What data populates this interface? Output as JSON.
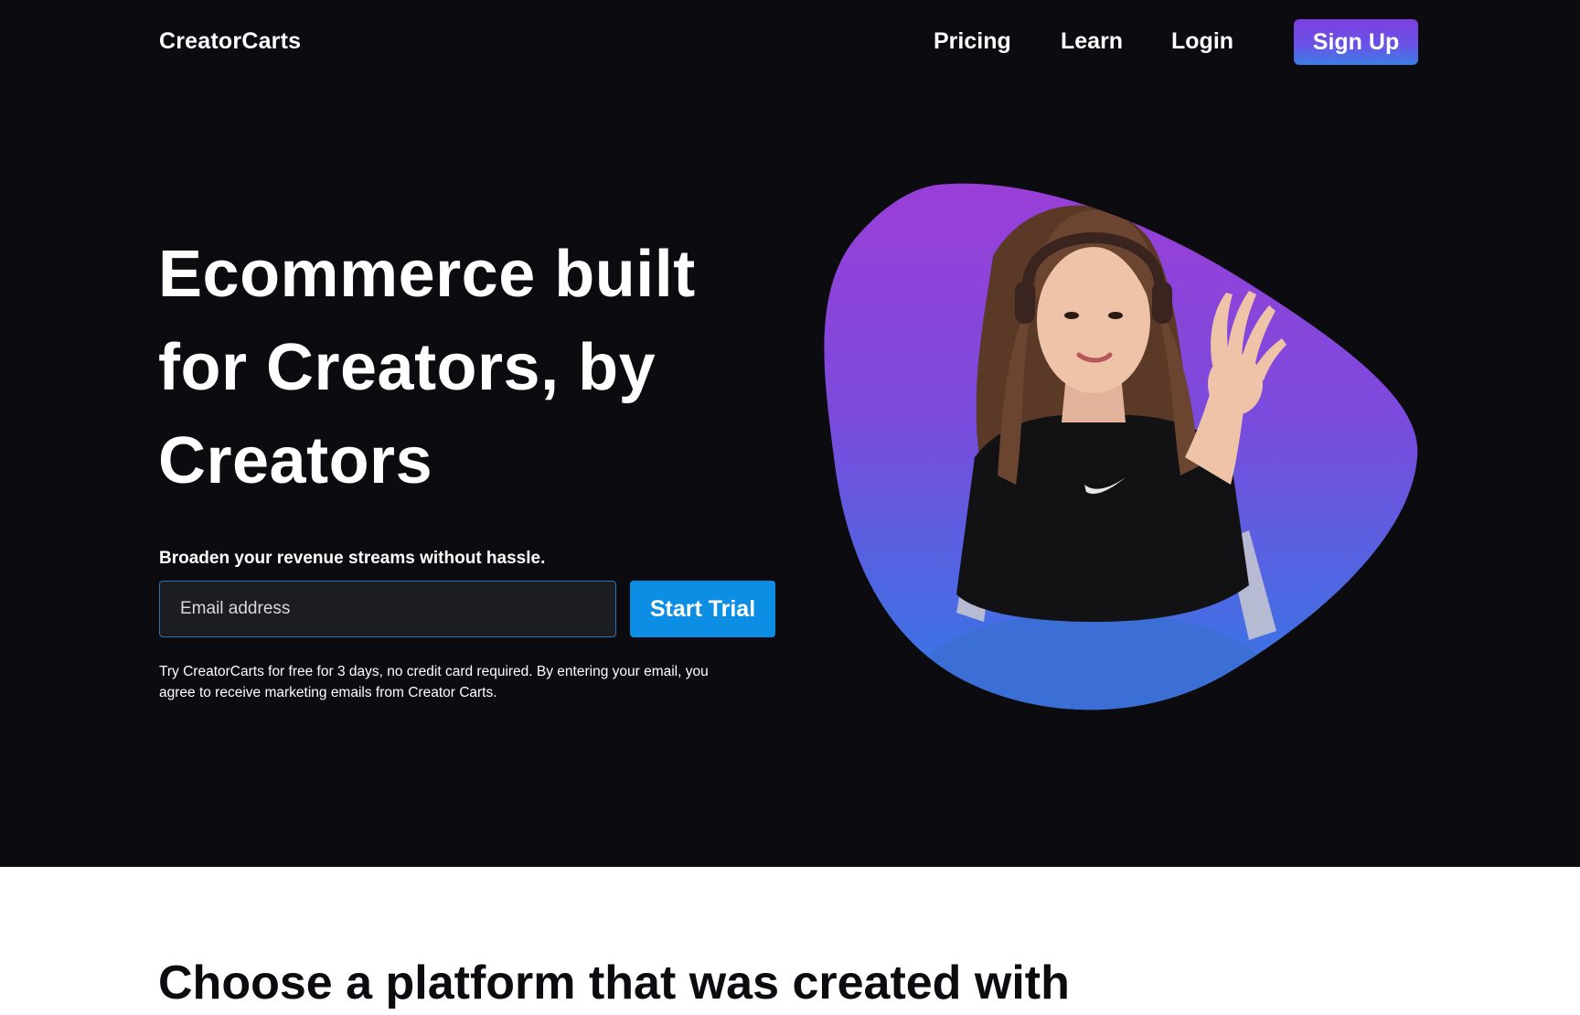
{
  "header": {
    "brand": "CreatorCarts",
    "nav": {
      "pricing": "Pricing",
      "learn": "Learn",
      "login": "Login"
    },
    "signup_label": "Sign Up"
  },
  "hero": {
    "headline": {
      "line1": "Ecommerce built",
      "line2": "for Creators, by",
      "line3": "Creators"
    },
    "subtitle": "Broaden your revenue streams without hassle.",
    "email_placeholder": "Email address",
    "cta_label": "Start Trial",
    "disclaimer": {
      "line1": "Try CreatorCarts for free for 3 days, no credit card required. By entering your email, you",
      "line2": "agree to receive marketing emails from Creator Carts."
    },
    "image_alt": "Creator with headset waving",
    "colors": {
      "blob_top": "#9a3ed8",
      "blob_bottom": "#2f7be6",
      "background": "#0b0b10"
    }
  },
  "section_two": {
    "heading": "Choose a platform that was created with"
  }
}
